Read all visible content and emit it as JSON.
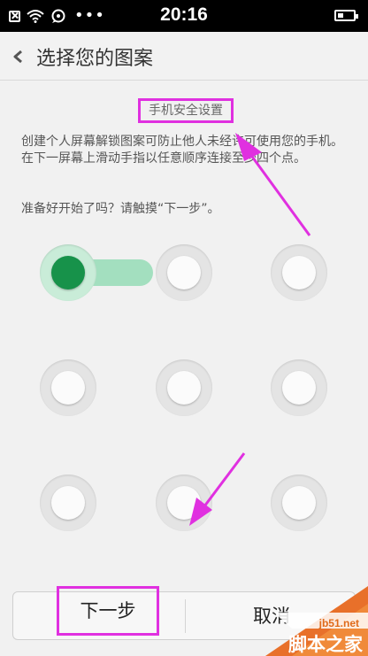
{
  "status_bar": {
    "time": "20:16",
    "dots": "•••",
    "icons": [
      "close-box-icon",
      "wifi-icon",
      "message-icon",
      "battery-icon"
    ]
  },
  "header": {
    "title": "选择您的图案"
  },
  "content": {
    "section_label": "手机安全设置",
    "description": "创建个人屏幕解锁图案可防止他人未经许可使用您的手机。在下一屏幕上滑动手指以任意顺序连接至少四个点。",
    "prompt": "准备好开始了吗？请触摸“下一步”。"
  },
  "pattern": {
    "active_dots": [
      0
    ],
    "trail_from": 0,
    "trail_to": 1
  },
  "buttons": {
    "next_label": "下一步",
    "cancel_label": "取消"
  },
  "watermark": {
    "url": "jb51.net",
    "name": "脚本之家"
  },
  "colors": {
    "highlight": "#e030e0",
    "active_dot": "#17924a",
    "trail": "#a3dfbf"
  }
}
